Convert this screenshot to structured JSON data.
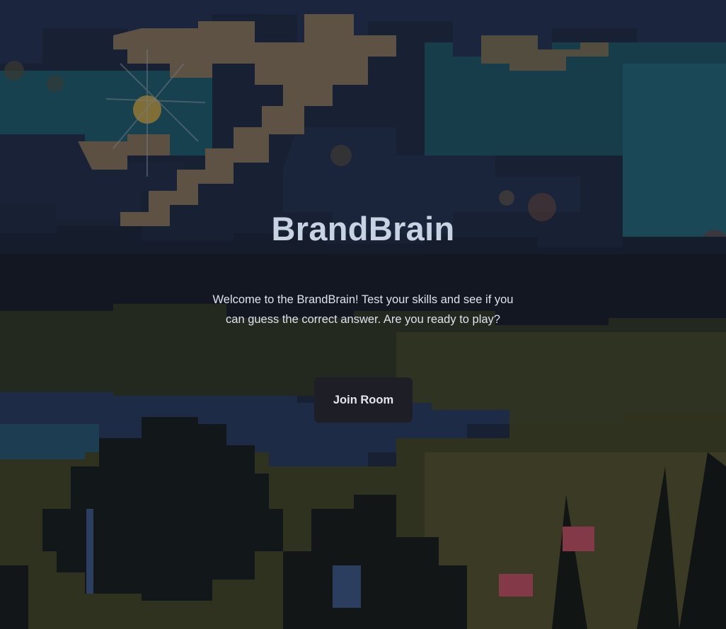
{
  "app": {
    "title": "BrandBrain"
  },
  "hero": {
    "welcome_text": "Welcome to the BrandBrain! Test your skills and see if you can guess the correct answer. Are you ready to play?",
    "join_button_label": "Join Room"
  },
  "background": {
    "description_icon": "pixel-landscape-image",
    "colors": {
      "sky_dark": "#1e2a44",
      "cloud_tan": "#7a6a55",
      "teal": "#1f5a68",
      "field": "#4a4a28",
      "lake": "#2a3e5e"
    }
  }
}
